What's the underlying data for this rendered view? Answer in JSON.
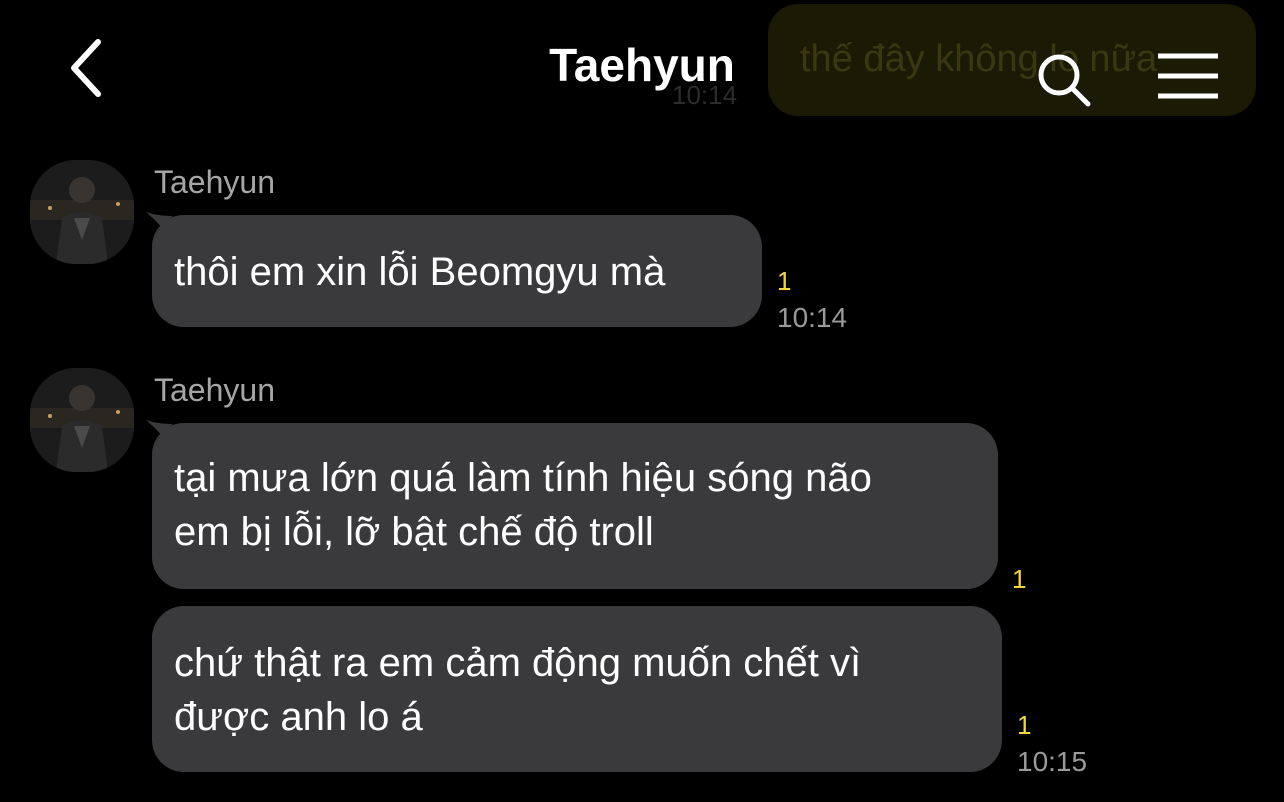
{
  "header": {
    "title": "Taehyun",
    "back_icon": "chevron-left-icon",
    "search_icon": "search-icon",
    "menu_icon": "hamburger-menu-icon"
  },
  "previous_message": {
    "text": "thế đây không lo nữa",
    "time": "10:14"
  },
  "messages": [
    {
      "sender": "Taehyun",
      "lines": [
        "thôi em xin lỗi Beomgyu mà"
      ],
      "unread": "1",
      "time": "10:14"
    },
    {
      "sender": "Taehyun",
      "lines": [
        "tại mưa lớn quá làm tính hiệu sóng não",
        "em bị lỗi, lỡ bật chế độ troll"
      ],
      "unread": "1",
      "time": ""
    },
    {
      "sender": "",
      "lines": [
        "chứ thật ra em cảm động muốn chết vì",
        "được anh lo á"
      ],
      "unread": "1",
      "time": "10:15"
    }
  ],
  "colors": {
    "background": "#000000",
    "bubble": "#3a3a3c",
    "unread": "#f5d63c",
    "meta_text": "#9a9a9a"
  }
}
